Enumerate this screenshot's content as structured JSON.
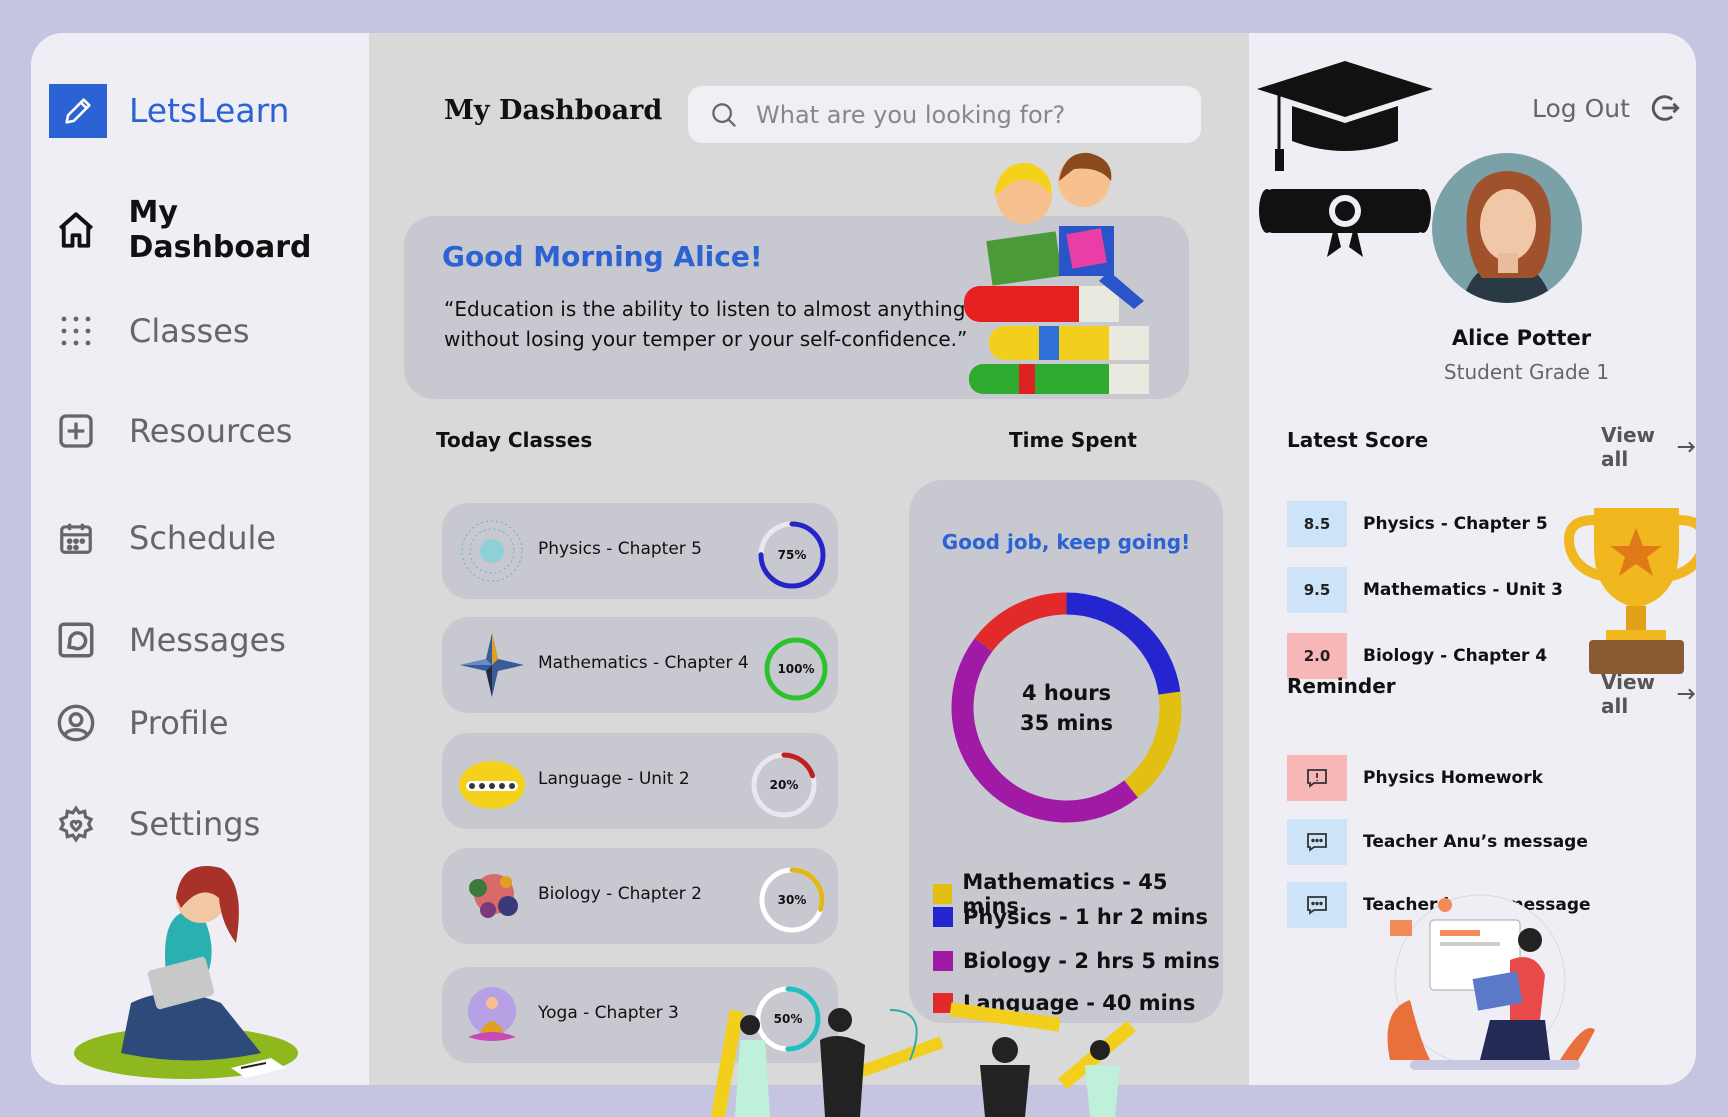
{
  "app": {
    "name": "LetsLearn"
  },
  "sidebar": {
    "items": [
      {
        "label": "My Dashboard",
        "icon": "home-icon",
        "active": true
      },
      {
        "label": "Classes",
        "icon": "grid-dots-icon"
      },
      {
        "label": "Resources",
        "icon": "plus-square-icon"
      },
      {
        "label": "Schedule",
        "icon": "calendar-icon"
      },
      {
        "label": "Messages",
        "icon": "message-square-icon"
      },
      {
        "label": "Profile",
        "icon": "user-circle-icon"
      },
      {
        "label": "Settings",
        "icon": "gear-icon"
      }
    ]
  },
  "header": {
    "title": "My Dashboard",
    "search_placeholder": "What are you looking for?"
  },
  "greeting": {
    "hello": "Good Morning Alice!",
    "quote": "“Education is the ability to listen to almost anything without losing your temper or your self-confidence.”"
  },
  "today_classes": {
    "heading": "Today Classes",
    "items": [
      {
        "name": "Physics - Chapter 5",
        "progress_label": "75%",
        "progress": 75,
        "color": "#2424c8"
      },
      {
        "name": "Mathematics - Chapter 4",
        "progress_label": "100%",
        "progress": 100,
        "color": "#2bc22b"
      },
      {
        "name": "Language - Unit 2",
        "progress_label": "20%",
        "progress": 20,
        "color": "#c02020"
      },
      {
        "name": "Biology - Chapter 2",
        "progress_label": "30%",
        "progress": 30,
        "color": "#e0b818"
      },
      {
        "name": "Yoga - Chapter 3",
        "progress_label": "50%",
        "progress": 50,
        "color": "#20c0c0"
      }
    ]
  },
  "time_spent": {
    "heading": "Time Spent",
    "message": "Good job, keep going!",
    "total_line1": "4 hours",
    "total_line2": "35 mins",
    "legend": [
      {
        "label": "Mathematics - 45 mins",
        "color": "#e2c012",
        "minutes": 45
      },
      {
        "label": "Physics - 1 hr 2 mins",
        "color": "#2525d0",
        "minutes": 62
      },
      {
        "label": "Biology - 2 hrs 5 mins",
        "color": "#a01aa5",
        "minutes": 125
      },
      {
        "label": "Language - 40 mins",
        "color": "#e22a2a",
        "minutes": 40
      }
    ]
  },
  "user": {
    "logout_label": "Log Out",
    "name": "Alice Potter",
    "grade": "Student Grade 1"
  },
  "latest_score": {
    "heading": "Latest Score",
    "view_all": "View all",
    "items": [
      {
        "score": "8.5",
        "subject": "Physics - Chapter 5",
        "color": "#cde4f8"
      },
      {
        "score": "9.5",
        "subject": "Mathematics - Unit 3",
        "color": "#cde4f8"
      },
      {
        "score": "2.0",
        "subject": "Biology - Chapter 4",
        "color": "#f7b7b7"
      }
    ]
  },
  "reminder": {
    "heading": "Reminder",
    "view_all": "View all",
    "items": [
      {
        "label": "Physics Homework",
        "icon": "alert-message-icon",
        "color": "#f7b7b7"
      },
      {
        "label": "Teacher Anu’s message",
        "icon": "chat-icon",
        "color": "#cde4f8"
      },
      {
        "label": "Teacher james message",
        "icon": "chat-icon",
        "color": "#cde4f8"
      }
    ]
  }
}
